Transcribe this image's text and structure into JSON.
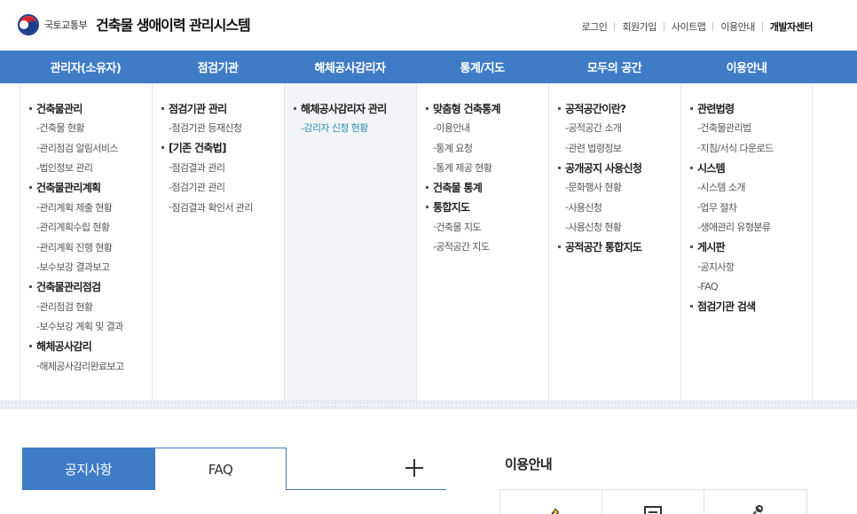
{
  "header": {
    "ministry": "국토교통부",
    "system_title": "건축물 생애이력 관리시스템",
    "util_links": [
      "로그인",
      "회원가입",
      "사이트맵",
      "이용안내",
      "개발자센터"
    ]
  },
  "gnb": [
    "관리자(소유자)",
    "점검기관",
    "해체공사감리자",
    "통계/지도",
    "모두의 공간",
    "이용안내"
  ],
  "mega": [
    {
      "groups": [
        {
          "title": "건축물관리",
          "items": [
            "건축물 현황",
            "관리점검 알림서비스",
            "법인정보 관리"
          ]
        },
        {
          "title": "건축물관리계획",
          "items": [
            "관리계획 제출 현황",
            "관리계획수립 현황",
            "관리계획 진행 현황",
            "보수보강 결과보고"
          ]
        },
        {
          "title": "건축물관리점검",
          "items": [
            "관리점검 현황",
            "보수보강 계획 및 결과"
          ]
        },
        {
          "title": "해체공사감리",
          "items": [
            "해체공사감리완료보고"
          ]
        }
      ]
    },
    {
      "groups": [
        {
          "title": "점검기관 관리",
          "items": [
            "점검기관 등재신청"
          ]
        },
        {
          "title": "[기존 건축법]",
          "items": [
            "점검결과 관리",
            "점검기관 관리",
            "점검결과 확인서 관리"
          ]
        }
      ]
    },
    {
      "groups": [
        {
          "title": "해체공사감리자 관리",
          "items": [
            "감리자 신청 현황"
          ]
        }
      ]
    },
    {
      "groups": [
        {
          "title": "맞춤형 건축통계",
          "items": [
            "이용안내",
            "통계 요청",
            "통계 제공 현황"
          ]
        },
        {
          "title": "건축물 통계",
          "items": []
        },
        {
          "title": "통합지도",
          "items": [
            "건축물 지도",
            "공적공간 지도"
          ]
        }
      ]
    },
    {
      "groups": [
        {
          "title": "공적공간이란?",
          "items": [
            "공적공간 소개",
            "관련 법령정보"
          ]
        },
        {
          "title": "공개공지 사용신청",
          "items": [
            "문화행사 현황",
            "사용신청",
            "사용신청 현황"
          ]
        },
        {
          "title": "공적공간 통합지도",
          "items": []
        }
      ]
    },
    {
      "groups": [
        {
          "title": "관련법령",
          "items": [
            "건축물관리법",
            "지침/서식 다운로드"
          ]
        },
        {
          "title": "시스템",
          "items": [
            "시스템 소개",
            "업무 절차",
            "생애관리 유형분류"
          ]
        },
        {
          "title": "게시판",
          "items": [
            "공지사항",
            "FAQ"
          ]
        },
        {
          "title": "점검기관 검색",
          "items": []
        }
      ]
    }
  ],
  "tabs": [
    "공지사항",
    "FAQ"
  ],
  "guide": {
    "title": "이용안내"
  },
  "colors": {
    "primary": "#3f7cc6",
    "highlight": "#2f8fb5"
  }
}
